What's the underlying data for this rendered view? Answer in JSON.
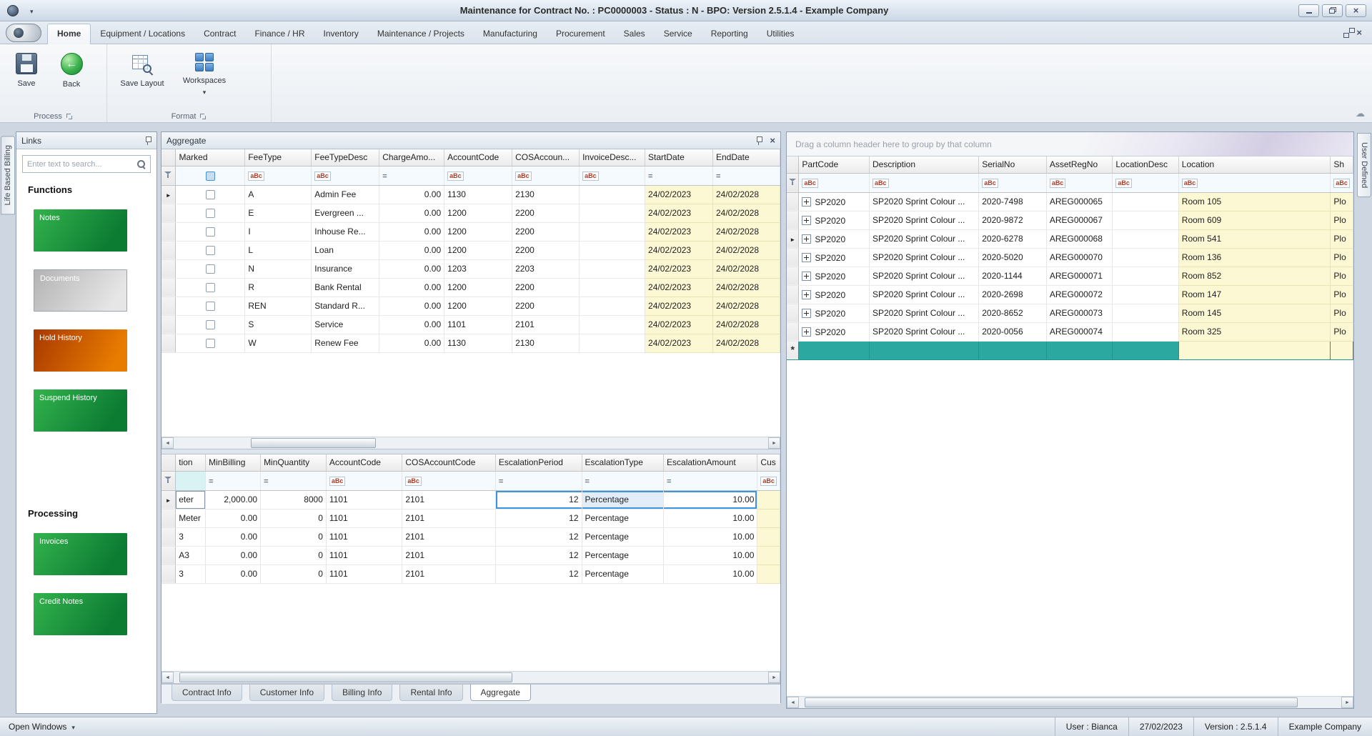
{
  "titlebar": {
    "title": "Maintenance for Contract No. : PC0000003 - Status : N - BPO: Version 2.5.1.4 - Example Company"
  },
  "icons": {
    "text_filter": "aBc",
    "equals_filter": "="
  },
  "ribbon": {
    "tabs": [
      {
        "label": "Home",
        "active": true
      },
      {
        "label": "Equipment / Locations"
      },
      {
        "label": "Contract"
      },
      {
        "label": "Finance / HR"
      },
      {
        "label": "Inventory"
      },
      {
        "label": "Maintenance / Projects"
      },
      {
        "label": "Manufacturing"
      },
      {
        "label": "Procurement"
      },
      {
        "label": "Sales"
      },
      {
        "label": "Service"
      },
      {
        "label": "Reporting"
      },
      {
        "label": "Utilities"
      }
    ],
    "buttons": {
      "save": "Save",
      "back": "Back",
      "save_layout": "Save Layout",
      "workspaces": "Workspaces"
    },
    "groups": {
      "process": "Process",
      "format": "Format"
    }
  },
  "side_tabs": {
    "left": "Life Based Billing",
    "right": "User Defined"
  },
  "links": {
    "caption": "Links",
    "search_placeholder": "Enter text to search...",
    "functions_heading": "Functions",
    "function_buttons": [
      {
        "label": "Notes",
        "variant": "green"
      },
      {
        "label": "Documents",
        "variant": "silver"
      },
      {
        "label": "Hold History",
        "variant": "orange"
      },
      {
        "label": "Suspend History",
        "variant": "green"
      }
    ],
    "processing_heading": "Processing",
    "processing_buttons": [
      {
        "label": "Invoices",
        "variant": "green"
      },
      {
        "label": "Credit Notes",
        "variant": "green"
      }
    ]
  },
  "aggregate": {
    "caption": "Aggregate",
    "fee_grid": {
      "columns": [
        "Marked",
        "FeeType",
        "FeeTypeDesc",
        "ChargeAmo...",
        "AccountCode",
        "COSAccoun...",
        "InvoiceDesc...",
        "StartDate",
        "EndDate"
      ],
      "rows": [
        {
          "_current": true,
          "feeType": "A",
          "feeTypeDesc": "Admin Fee",
          "charge": "0.00",
          "accountCode": "1130",
          "cosAccountCode": "2130",
          "invoiceDesc": "",
          "startDate": "24/02/2023",
          "endDate": "24/02/2028"
        },
        {
          "feeType": "E",
          "feeTypeDesc": "Evergreen ...",
          "charge": "0.00",
          "accountCode": "1200",
          "cosAccountCode": "2200",
          "invoiceDesc": "",
          "startDate": "24/02/2023",
          "endDate": "24/02/2028"
        },
        {
          "feeType": "I",
          "feeTypeDesc": "Inhouse Re...",
          "charge": "0.00",
          "accountCode": "1200",
          "cosAccountCode": "2200",
          "invoiceDesc": "",
          "startDate": "24/02/2023",
          "endDate": "24/02/2028"
        },
        {
          "feeType": "L",
          "feeTypeDesc": "Loan",
          "charge": "0.00",
          "accountCode": "1200",
          "cosAccountCode": "2200",
          "invoiceDesc": "",
          "startDate": "24/02/2023",
          "endDate": "24/02/2028"
        },
        {
          "feeType": "N",
          "feeTypeDesc": "Insurance",
          "charge": "0.00",
          "accountCode": "1203",
          "cosAccountCode": "2203",
          "invoiceDesc": "",
          "startDate": "24/02/2023",
          "endDate": "24/02/2028"
        },
        {
          "feeType": "R",
          "feeTypeDesc": "Bank Rental",
          "charge": "0.00",
          "accountCode": "1200",
          "cosAccountCode": "2200",
          "invoiceDesc": "",
          "startDate": "24/02/2023",
          "endDate": "24/02/2028"
        },
        {
          "feeType": "REN",
          "feeTypeDesc": "Standard R...",
          "charge": "0.00",
          "accountCode": "1200",
          "cosAccountCode": "2200",
          "invoiceDesc": "",
          "startDate": "24/02/2023",
          "endDate": "24/02/2028"
        },
        {
          "feeType": "S",
          "feeTypeDesc": "Service",
          "charge": "0.00",
          "accountCode": "1101",
          "cosAccountCode": "2101",
          "invoiceDesc": "",
          "startDate": "24/02/2023",
          "endDate": "24/02/2028"
        },
        {
          "feeType": "W",
          "feeTypeDesc": "Renew Fee",
          "charge": "0.00",
          "accountCode": "1130",
          "cosAccountCode": "2130",
          "invoiceDesc": "",
          "startDate": "24/02/2023",
          "endDate": "24/02/2028"
        }
      ]
    },
    "escalation_grid": {
      "columns": [
        "tion",
        "MinBilling",
        "MinQuantity",
        "AccountCode",
        "COSAccountCode",
        "EscalationPeriod",
        "EscalationType",
        "EscalationAmount",
        "Cus"
      ],
      "rows": [
        {
          "_current": true,
          "desc": "eter",
          "minBilling": "2,000.00",
          "minQuantity": "8000",
          "accountCode": "1101",
          "cosAccountCode": "2101",
          "escalationPeriod": "12",
          "escalationType": "Percentage",
          "escalationAmount": "10.00"
        },
        {
          "desc": "Meter",
          "minBilling": "0.00",
          "minQuantity": "0",
          "accountCode": "1101",
          "cosAccountCode": "2101",
          "escalationPeriod": "12",
          "escalationType": "Percentage",
          "escalationAmount": "10.00"
        },
        {
          "desc": "3",
          "minBilling": "0.00",
          "minQuantity": "0",
          "accountCode": "1101",
          "cosAccountCode": "2101",
          "escalationPeriod": "12",
          "escalationType": "Percentage",
          "escalationAmount": "10.00"
        },
        {
          "desc": "A3",
          "minBilling": "0.00",
          "minQuantity": "0",
          "accountCode": "1101",
          "cosAccountCode": "2101",
          "escalationPeriod": "12",
          "escalationType": "Percentage",
          "escalationAmount": "10.00"
        },
        {
          "desc": "3",
          "minBilling": "0.00",
          "minQuantity": "0",
          "accountCode": "1101",
          "cosAccountCode": "2101",
          "escalationPeriod": "12",
          "escalationType": "Percentage",
          "escalationAmount": "10.00"
        }
      ]
    },
    "doc_tabs": [
      {
        "label": "Contract Info"
      },
      {
        "label": "Customer Info"
      },
      {
        "label": "Billing Info"
      },
      {
        "label": "Rental Info"
      },
      {
        "label": "Aggregate",
        "active": true
      }
    ]
  },
  "equipment": {
    "group_hint": "Drag a column header here to group by that column",
    "columns": [
      "PartCode",
      "Description",
      "SerialNo",
      "AssetRegNo",
      "LocationDesc",
      "Location",
      "Sh"
    ],
    "rows": [
      {
        "partCode": "SP2020",
        "description": "SP2020 Sprint Colour ...",
        "serialNo": "2020-7498",
        "assetRegNo": "AREG000065",
        "locationDesc": "",
        "location": "Room 105",
        "extra": "Plo"
      },
      {
        "partCode": "SP2020",
        "description": "SP2020 Sprint Colour ...",
        "serialNo": "2020-9872",
        "assetRegNo": "AREG000067",
        "locationDesc": "",
        "location": "Room 609",
        "extra": "Plo"
      },
      {
        "_current": true,
        "partCode": "SP2020",
        "description": "SP2020 Sprint Colour ...",
        "serialNo": "2020-6278",
        "assetRegNo": "AREG000068",
        "locationDesc": "",
        "location": "Room 541",
        "extra": "Plo"
      },
      {
        "partCode": "SP2020",
        "description": "SP2020 Sprint Colour ...",
        "serialNo": "2020-5020",
        "assetRegNo": "AREG000070",
        "locationDesc": "",
        "location": "Room 136",
        "extra": "Plo"
      },
      {
        "partCode": "SP2020",
        "description": "SP2020 Sprint Colour ...",
        "serialNo": "2020-1144",
        "assetRegNo": "AREG000071",
        "locationDesc": "",
        "location": "Room 852",
        "extra": "Plo"
      },
      {
        "partCode": "SP2020",
        "description": "SP2020 Sprint Colour ...",
        "serialNo": "2020-2698",
        "assetRegNo": "AREG000072",
        "locationDesc": "",
        "location": "Room 147",
        "extra": "Plo"
      },
      {
        "partCode": "SP2020",
        "description": "SP2020 Sprint Colour ...",
        "serialNo": "2020-8652",
        "assetRegNo": "AREG000073",
        "locationDesc": "",
        "location": "Room 145",
        "extra": "Plo"
      },
      {
        "partCode": "SP2020",
        "description": "SP2020 Sprint Colour ...",
        "serialNo": "2020-0056",
        "assetRegNo": "AREG000074",
        "locationDesc": "",
        "location": "Room 325",
        "extra": "Plo"
      }
    ]
  },
  "statusbar": {
    "open_windows": "Open Windows",
    "items": [
      "User : Bianca",
      "27/02/2023",
      "Version : 2.5.1.4",
      "Example Company"
    ]
  }
}
